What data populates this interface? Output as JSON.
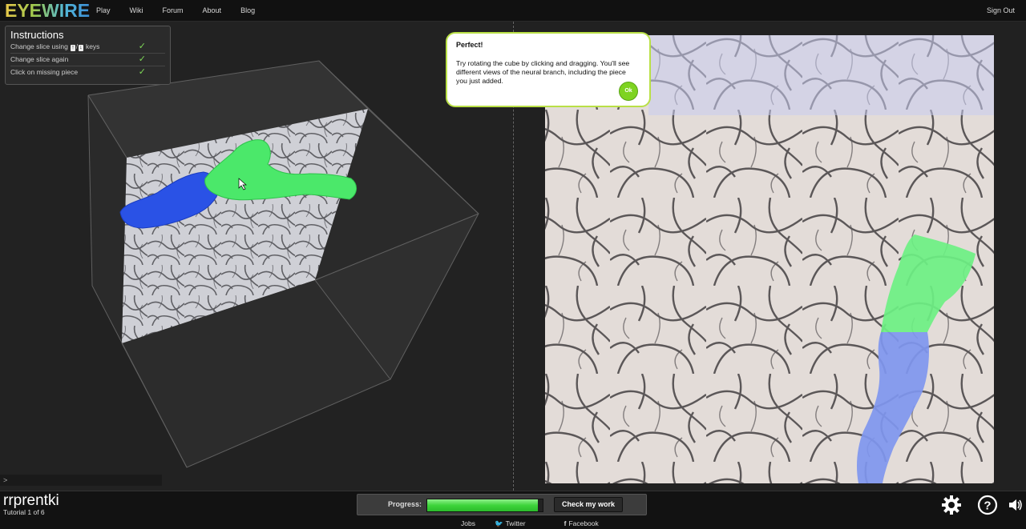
{
  "app": {
    "logo": "EYEWIRE"
  },
  "nav": {
    "items": [
      "Play",
      "Wiki",
      "Forum",
      "About",
      "Blog"
    ],
    "sign_out": "Sign Out"
  },
  "instructions": {
    "title": "Instructions",
    "steps": [
      {
        "pre": "Change slice using",
        "key1": "↑",
        "key2": "↓",
        "post": "keys",
        "check": "✓"
      },
      {
        "label": "Change slice again",
        "check": "✓"
      },
      {
        "label": "Click on missing piece",
        "check": "✓"
      }
    ]
  },
  "console": {
    "prompt": ">"
  },
  "tooltip": {
    "title": "Perfect!",
    "text": "Try rotating the cube by clicking and dragging. You'll see different views of the neural branch, including the piece you just added.",
    "ok_label": "Ok"
  },
  "user": {
    "name": "rrprentki",
    "tutorial": "Tutorial 1 of 6"
  },
  "progress": {
    "label": "Progress:",
    "value": 0.96
  },
  "check_work": {
    "label": "Check my work"
  },
  "footer": {
    "jobs": "Jobs",
    "twitter": "Twitter",
    "facebook": "Facebook"
  },
  "colors": {
    "accent_green": "#7ed321",
    "segment_green": "#4be86a",
    "segment_blue": "#2f55e0"
  }
}
